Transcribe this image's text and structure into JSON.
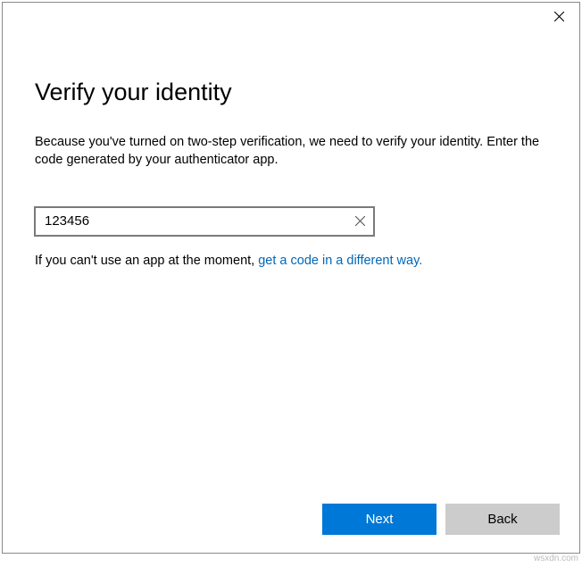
{
  "dialog": {
    "heading": "Verify your identity",
    "description": "Because you've turned on two-step verification, we need to verify your identity. Enter the code generated by your authenticator app.",
    "code_input": {
      "value": "123456",
      "placeholder": ""
    },
    "alt_prefix": "If you can't use an app at the moment, ",
    "alt_link": "get a code in a different way.",
    "buttons": {
      "next": "Next",
      "back": "Back"
    }
  },
  "watermark": "wsxdn.com"
}
